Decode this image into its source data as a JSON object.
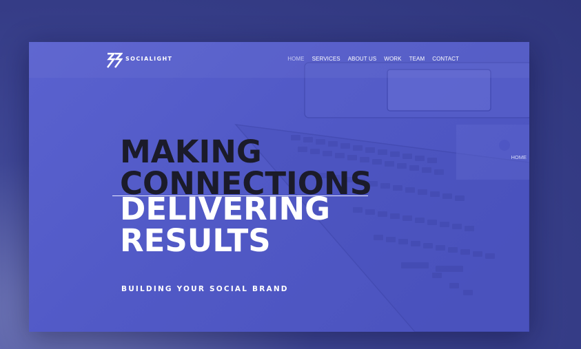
{
  "brand": {
    "name": "SOCIALIGHT"
  },
  "nav": {
    "items": [
      {
        "label": "HOME",
        "active": true
      },
      {
        "label": "SERVICES",
        "active": false
      },
      {
        "label": "ABOUT US",
        "active": false
      },
      {
        "label": "WORK",
        "active": false
      },
      {
        "label": "TEAM",
        "active": false
      },
      {
        "label": "CONTACT",
        "active": false
      }
    ]
  },
  "side_nav": {
    "label": "HOME"
  },
  "hero": {
    "headline_dark": [
      "MAKING",
      "CONNECTIONS"
    ],
    "headline_light": [
      "DELIVERING",
      "RESULTS"
    ],
    "tagline": "BUILDING YOUR SOCIAL BRAND"
  },
  "colors": {
    "page_background": "#3a418d",
    "hero_overlay": "#5159c6",
    "headline_dark": "#1b1b2a",
    "headline_light": "#ffffff",
    "nav_active": "#c9ccf3"
  },
  "icons": {
    "logo": "socialight-chevron-logo-icon"
  }
}
